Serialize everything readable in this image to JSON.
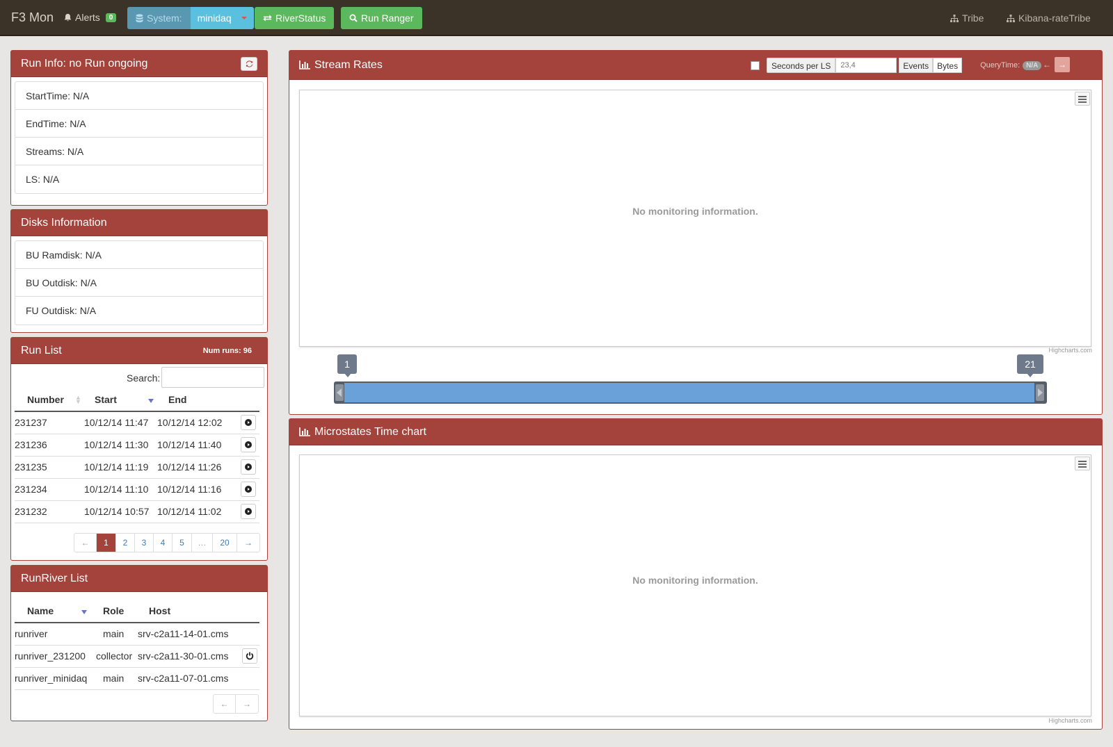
{
  "nav": {
    "brand": "F3 Mon",
    "alerts_label": "Alerts",
    "alerts_count": "0",
    "system_label": "System:",
    "system_value": "minidaq",
    "riverstatus_label": "RiverStatus",
    "runranger_label": "Run Ranger",
    "tribe_label": "Tribe",
    "kibana_label": "Kibana-rateTribe"
  },
  "run_info": {
    "title": "Run Info: no Run ongoing",
    "items": [
      "StartTime: N/A",
      "EndTime: N/A",
      "Streams: N/A",
      "LS: N/A"
    ]
  },
  "disks": {
    "title": "Disks Information",
    "items": [
      "BU Ramdisk: N/A",
      "BU Outdisk: N/A",
      "FU Outdisk: N/A"
    ]
  },
  "run_list": {
    "title": "Run List",
    "num_runs": "Num runs: 96",
    "search_label": "Search:",
    "search_value": "",
    "columns": [
      "Number",
      "Start",
      "End"
    ],
    "rows": [
      {
        "number": "231237",
        "start": "10/12/14 11:47",
        "end": "10/12/14 12:02"
      },
      {
        "number": "231236",
        "start": "10/12/14 11:30",
        "end": "10/12/14 11:40"
      },
      {
        "number": "231235",
        "start": "10/12/14 11:19",
        "end": "10/12/14 11:26"
      },
      {
        "number": "231234",
        "start": "10/12/14 11:10",
        "end": "10/12/14 11:16"
      },
      {
        "number": "231232",
        "start": "10/12/14 10:57",
        "end": "10/12/14 11:02"
      }
    ],
    "pagination": {
      "prev": "←",
      "pages": [
        "1",
        "2",
        "3",
        "4",
        "5",
        "…",
        "20"
      ],
      "active_page": "1",
      "next": "→"
    }
  },
  "runriver": {
    "title": "RunRiver List",
    "columns": [
      "Name",
      "Role",
      "Host"
    ],
    "rows": [
      {
        "name": "runriver",
        "role": "main",
        "host": "srv-c2a11-14-01.cms",
        "has_button": false
      },
      {
        "name": "runriver_231200",
        "role": "collector",
        "host": "srv-c2a11-30-01.cms",
        "has_button": true
      },
      {
        "name": "runriver_minidaq",
        "role": "main",
        "host": "srv-c2a11-07-01.cms",
        "has_button": false
      }
    ],
    "pagination": {
      "prev": "←",
      "next": "→"
    }
  },
  "stream_rates": {
    "title": "Stream Rates",
    "seconds_per_ls_label": "Seconds per LS",
    "seconds_per_ls_checked": false,
    "ls_range_placeholder": "23,4",
    "events_label": "Events",
    "bytes_label": "Bytes",
    "selected_unit": "Bytes",
    "query_time_label": "QueryTime:",
    "query_time_value": "N/A",
    "prev_arrow": "←",
    "next_arrow": "→",
    "no_data": "No monitoring information.",
    "credit": "Highcharts.com",
    "navigator_min": "1",
    "navigator_max": "21"
  },
  "microstates": {
    "title": "Microstates Time chart",
    "no_data": "No monitoring information.",
    "credit": "Highcharts.com"
  },
  "colors": {
    "panel_header": "#a4433b",
    "navbar": "#3b3328",
    "green_button": "#5cb85c",
    "info_button": "#5bc0de",
    "navigator_fill": "#69a1d8"
  }
}
